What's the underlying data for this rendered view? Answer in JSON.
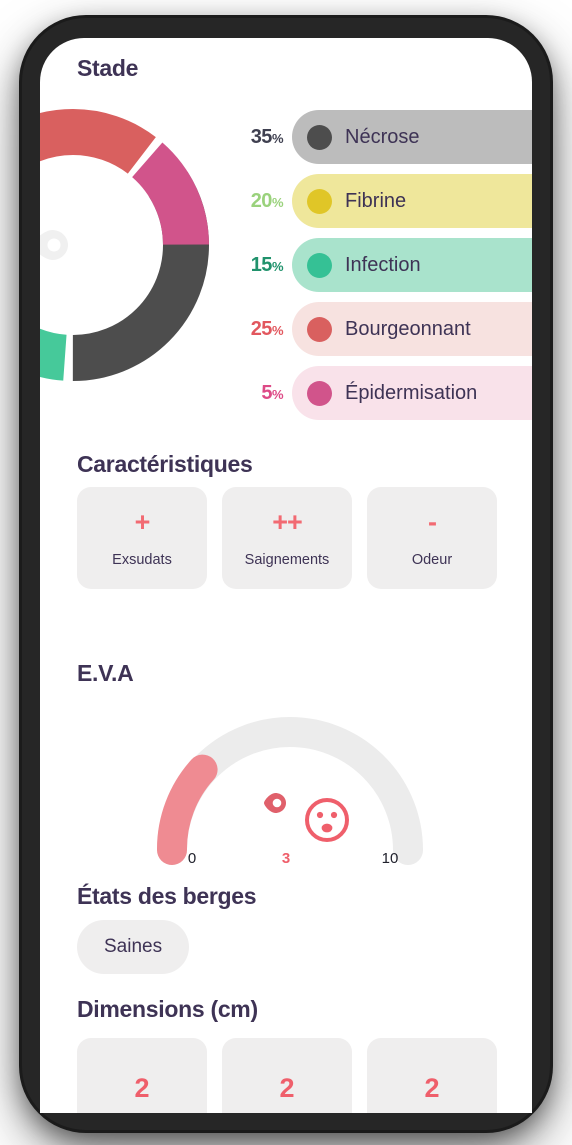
{
  "theme": {
    "heading_color": "#3e3355",
    "accent_red": "#ef5f6b",
    "card_bg": "#efeeee",
    "screen_bg": "#ffffff",
    "bezel_color": "#262626"
  },
  "stade": {
    "title": "Stade",
    "center_icon": "droplet-icon",
    "chart_data": {
      "type": "pie",
      "title": "Stade",
      "variant": "donut",
      "categories": [
        "Nécrose",
        "Fibrine",
        "Infection",
        "Bourgeonnant",
        "Épidermisation"
      ],
      "values": [
        35,
        20,
        15,
        25,
        5
      ],
      "unit": "%",
      "colors": [
        "#4d4d4d",
        "#e0c627",
        "#46c99a",
        "#d9605f",
        "#d1548b"
      ],
      "legend_position": "right",
      "grid": false
    },
    "legend": [
      {
        "pct": "35",
        "sym": "%",
        "label": "Nécrose",
        "dot_color": "#4d4d4d",
        "bar_color": "#bcbcbc",
        "pct_color": "#3f4050"
      },
      {
        "pct": "20",
        "sym": "%",
        "label": "Fibrine",
        "dot_color": "#e0c627",
        "bar_color": "#efe79b",
        "pct_color": "#9ad27c"
      },
      {
        "pct": "15",
        "sym": "%",
        "label": "Infection",
        "dot_color": "#35c195",
        "bar_color": "#a9e3cc",
        "pct_color": "#20926c"
      },
      {
        "pct": "25",
        "sym": "%",
        "label": "Bourgeonnant",
        "dot_color": "#d9605f",
        "bar_color": "#f7e2e0",
        "pct_color": "#e2575e"
      },
      {
        "pct": "5",
        "sym": "%",
        "label": "Épidermisation",
        "dot_color": "#d1548b",
        "bar_color": "#f9e2ea",
        "pct_color": "#dd4a86"
      }
    ]
  },
  "caracteristiques": {
    "title": "Caractéristiques",
    "items": [
      {
        "value": "+",
        "label": "Exsudats"
      },
      {
        "value": "++",
        "label": "Saignements"
      },
      {
        "value": "-",
        "label": "Odeur"
      }
    ]
  },
  "eva": {
    "title": "E.V.A",
    "face_icon": "neutral-face-icon",
    "marker_icon": "droplet-marker-icon",
    "chart_data": {
      "type": "gauge",
      "title": "E.V.A",
      "value": 3,
      "min": 0,
      "max": 10,
      "tick_labels": [
        "0",
        "3",
        "10"
      ],
      "tick_values": [
        0,
        3,
        10
      ],
      "fill_color": "#ef8b92",
      "track_color": "#ececec"
    },
    "ticks": [
      {
        "label": "0",
        "current": false
      },
      {
        "label": "3",
        "current": true
      },
      {
        "label": "10",
        "current": false
      }
    ]
  },
  "berges": {
    "title": "États des berges",
    "chip": "Saines"
  },
  "dimensions": {
    "title": "Dimensions (cm)",
    "values": [
      "2",
      "2",
      "2"
    ]
  }
}
